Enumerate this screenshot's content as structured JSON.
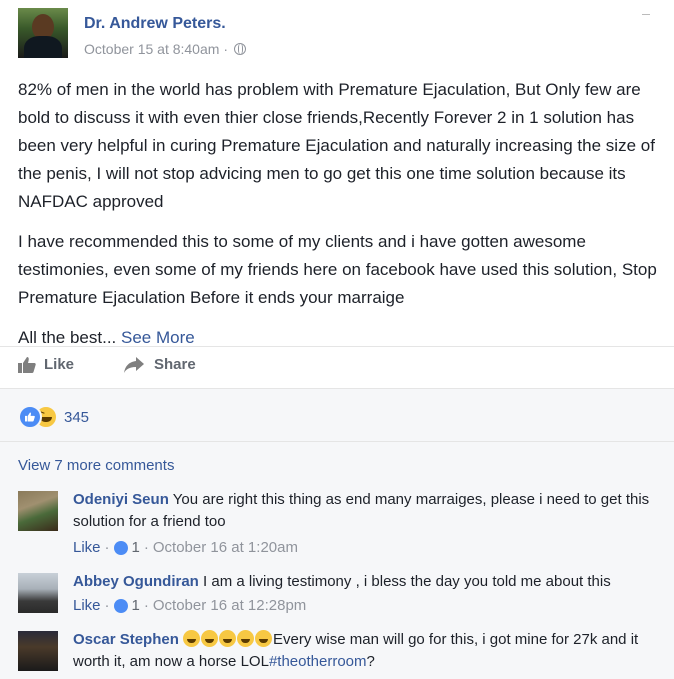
{
  "post": {
    "author": "Dr. Andrew Peters",
    "author_suffix": ".",
    "timestamp": "October 15 at 8:40am",
    "separator": "·",
    "privacy_icon": "globe-icon",
    "paragraphs": [
      "82% of men in the world has problem with Premature Ejaculation, But Only few are bold to discuss it with even thier close friends,Recently Forever 2 in 1 solution has been very helpful in curing Premature Ejaculation and naturally increasing the size of the penis, I will not stop advicing men to go get this one time solution because its NAFDAC approved",
      "I have recommended this to some of my clients and i have gotten awesome testimonies, even some of my friends here on facebook have used this solution, Stop Premature Ejaculation Before it ends your marraige"
    ],
    "closing_text": "All the best...",
    "see_more": "See More"
  },
  "actions": {
    "like_label": "Like",
    "share_label": "Share"
  },
  "reactions": {
    "count": "345",
    "types": [
      "like-icon",
      "haha-icon"
    ]
  },
  "comments": {
    "view_more": "View 7 more comments",
    "items": [
      {
        "name": "Odeniyi Seun",
        "text": "You are right this thing as end many marraiges, please i need to get this solution for a friend too",
        "like_label": "Like",
        "sep": "·",
        "likes": "1",
        "time": "October 16 at 1:20am"
      },
      {
        "name": "Abbey Ogundiran",
        "text": "I am a living testimony , i bless the day you told me about this",
        "like_label": "Like",
        "sep": "·",
        "likes": "1",
        "time": "October 16 at 12:28pm"
      },
      {
        "name": "Oscar Stephen",
        "emoji_count": 5,
        "text": "Every wise man will go for this, i got mine for 27k and it worth it, am now a horse LOL",
        "hashtag": "#theotherroom",
        "trailing": "?"
      }
    ]
  },
  "colors": {
    "link": "#365899",
    "meta": "#90949c",
    "text": "#1d2129",
    "comments_bg": "#f6f7f9"
  }
}
